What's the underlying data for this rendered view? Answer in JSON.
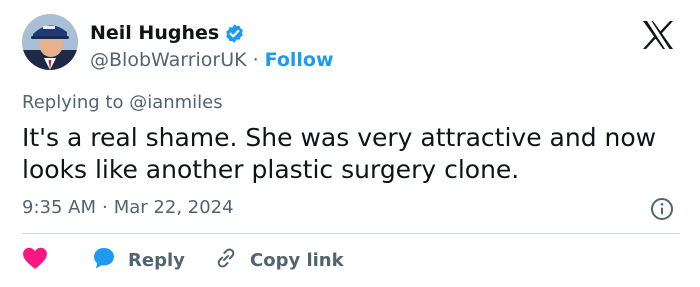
{
  "author": {
    "name": "Neil Hughes",
    "handle": "@BlobWarriorUK",
    "separator": "·",
    "follow_label": "Follow"
  },
  "reply_to": "Replying to @ianmiles",
  "tweet": {
    "text": "It's a real shame. She was very attractive and now looks like another plastic surgery clone."
  },
  "meta": {
    "time": "9:35 AM",
    "separator": "·",
    "date": "Mar 22, 2024"
  },
  "actions": {
    "reply_label": "Reply",
    "copy_link_label": "Copy link"
  },
  "colors": {
    "accent": "#1d9bf0",
    "like": "#f91880",
    "text": "#0f1419",
    "muted": "#536471",
    "divider": "#cfd9de"
  },
  "icons": {
    "verified": "verified-badge-icon",
    "brand": "x-logo-icon",
    "info": "info-icon",
    "like": "heart-icon",
    "reply": "speech-bubble-icon",
    "copy": "link-icon"
  }
}
